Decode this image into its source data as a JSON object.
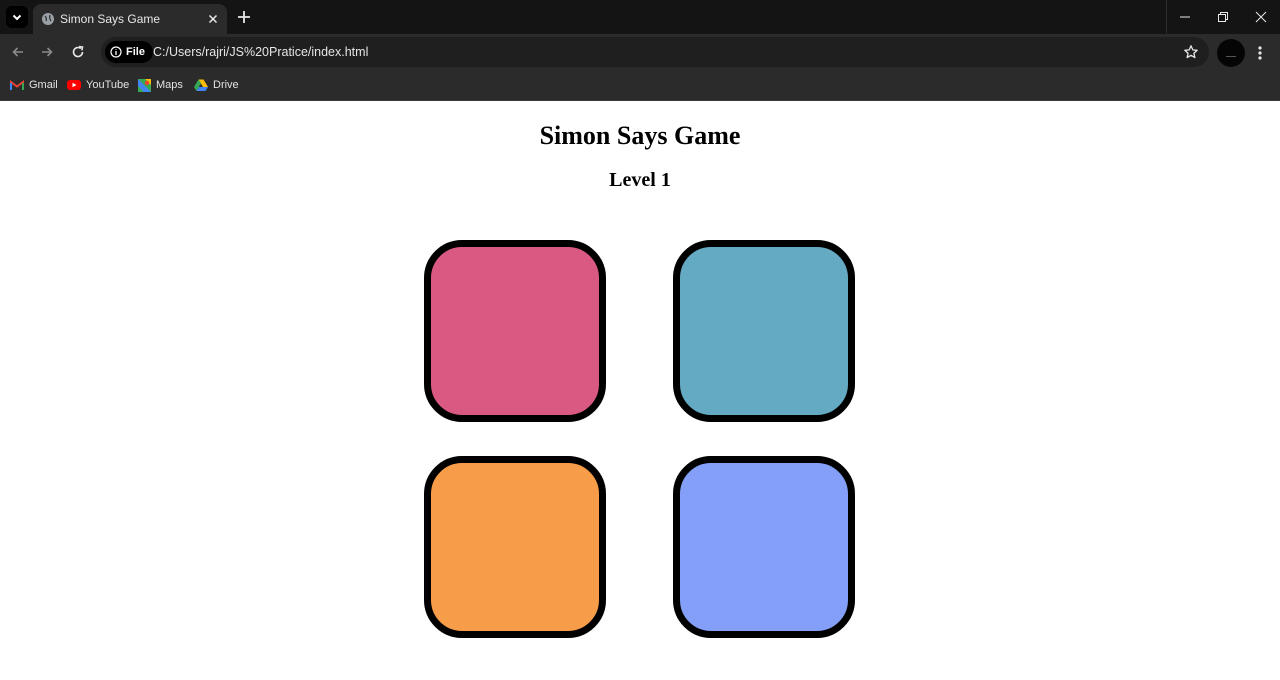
{
  "browser": {
    "tab": {
      "title": "Simon Says Game"
    },
    "address": {
      "chip_label": "File",
      "url": "C:/Users/rajri/JS%20Pratice/index.html"
    },
    "bookmarks": [
      {
        "label": "Gmail",
        "icon": "gmail-icon"
      },
      {
        "label": "YouTube",
        "icon": "youtube-icon"
      },
      {
        "label": "Maps",
        "icon": "maps-icon"
      },
      {
        "label": "Drive",
        "icon": "drive-icon"
      }
    ]
  },
  "page": {
    "title": "Simon Says Game",
    "level_text": "Level 1",
    "game_buttons": [
      {
        "id": "red",
        "color": "#da5982"
      },
      {
        "id": "blue",
        "color": "#64aac2"
      },
      {
        "id": "orange",
        "color": "#f79c48"
      },
      {
        "id": "purple",
        "color": "#849ff8"
      }
    ]
  }
}
